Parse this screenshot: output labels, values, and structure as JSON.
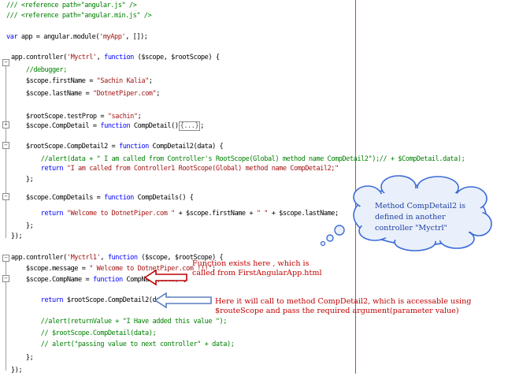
{
  "editor": {
    "lines": [
      [
        {
          "t": "/// <reference path=\"angular.js\" />",
          "c": "cm"
        }
      ],
      [
        {
          "t": "/// <reference path=\"angular.min.js\" />",
          "c": "cm"
        }
      ],
      [],
      [
        {
          "t": "var",
          "c": "kw"
        },
        {
          "t": " app = angular.module(",
          "c": "pl"
        },
        {
          "t": "'myApp'",
          "c": "str"
        },
        {
          "t": ", []);",
          "c": "pl"
        }
      ],
      [],
      [
        {
          "t": "app.controller(",
          "c": "pl"
        },
        {
          "t": "'Myctrl'",
          "c": "str"
        },
        {
          "t": ", ",
          "c": "pl"
        },
        {
          "t": "function",
          "c": "kw"
        },
        {
          "t": " ($scope, $rootScope) {",
          "c": "pl"
        }
      ],
      [
        {
          "t": "    //debugger;",
          "c": "cm"
        }
      ],
      [
        {
          "t": "    $scope.firstName = ",
          "c": "pl"
        },
        {
          "t": "\"Sachin Kalia\"",
          "c": "str"
        },
        {
          "t": ";",
          "c": "pl"
        }
      ],
      [
        {
          "t": "    $scope.lastName = ",
          "c": "pl"
        },
        {
          "t": "\"DotnetPiper.com\"",
          "c": "str"
        },
        {
          "t": ";",
          "c": "pl"
        }
      ],
      [],
      [
        {
          "t": "    $rootScope.testProp = ",
          "c": "pl"
        },
        {
          "t": "\"sachin\"",
          "c": "str"
        },
        {
          "t": ";",
          "c": "pl"
        }
      ],
      [
        {
          "t": "    $scope.CompDetail = ",
          "c": "pl"
        },
        {
          "t": "function",
          "c": "kw"
        },
        {
          "t": " CompDetail()",
          "c": "pl"
        },
        {
          "t": "{...}",
          "c": "box"
        },
        {
          "t": ";",
          "c": "pl"
        }
      ],
      [],
      [
        {
          "t": "    $rootScope.CompDetail2 = ",
          "c": "pl"
        },
        {
          "t": "function",
          "c": "kw"
        },
        {
          "t": " CompDetail2(data) {",
          "c": "pl"
        }
      ],
      [
        {
          "t": "        //alert(data + \" I am called from Controller's RootScope(Global) method name CompDetail2\");// + $CompDetail.data);",
          "c": "cm"
        }
      ],
      [
        {
          "t": "        ",
          "c": "pl"
        },
        {
          "t": "return",
          "c": "kw"
        },
        {
          "t": " ",
          "c": "pl"
        },
        {
          "t": "\"I am called from Controller1 RootScope(Global) method name CompDetail2;\"",
          "c": "str"
        }
      ],
      [
        {
          "t": "    };",
          "c": "pl"
        }
      ],
      [],
      [
        {
          "t": "    $scope.CompDetails = ",
          "c": "pl"
        },
        {
          "t": "function",
          "c": "kw"
        },
        {
          "t": " CompDetails() {",
          "c": "pl"
        }
      ],
      [
        {
          "t": "        ",
          "c": "pl"
        },
        {
          "t": "return",
          "c": "kw"
        },
        {
          "t": " ",
          "c": "pl"
        },
        {
          "t": "\"Welcome to DotnetPiper.com \"",
          "c": "str"
        },
        {
          "t": " + $scope.firstName + ",
          "c": "pl"
        },
        {
          "t": "\" \"",
          "c": "str"
        },
        {
          "t": " + $scope.lastName;",
          "c": "pl"
        }
      ],
      [
        {
          "t": "    };",
          "c": "pl"
        }
      ],
      [
        {
          "t": "});",
          "c": "pl"
        }
      ],
      [],
      [],
      [
        {
          "t": "app.controller(",
          "c": "pl"
        },
        {
          "t": "'Myctrl1'",
          "c": "str"
        },
        {
          "t": ", ",
          "c": "pl"
        },
        {
          "t": "function",
          "c": "kw"
        },
        {
          "t": " ($scope, $rootScope) {",
          "c": "pl"
        }
      ],
      [
        {
          "t": "    $scope.message = ",
          "c": "pl"
        },
        {
          "t": "\" Welcome to DotnetPiper.com !!!\"",
          "c": "str"
        },
        {
          "t": ";",
          "c": "pl"
        }
      ],
      [
        {
          "t": "    $scope.CompName = ",
          "c": "pl"
        },
        {
          "t": "function",
          "c": "kw"
        },
        {
          "t": " CompName(data) {",
          "c": "pl"
        }
      ],
      [],
      [
        {
          "t": "        ",
          "c": "pl"
        },
        {
          "t": "return",
          "c": "kw"
        },
        {
          "t": " $rootScope.CompDetail2(data);",
          "c": "pl"
        }
      ],
      [],
      [
        {
          "t": "        //alert(returnValue + \"I Have added this value \");",
          "c": "cm"
        }
      ],
      [
        {
          "t": "        // $rootScope.CompDetail(data);",
          "c": "cm"
        }
      ],
      [
        {
          "t": "        // alert(\"passing value to next controller\" + data);",
          "c": "cm"
        }
      ],
      [
        {
          "t": "    };",
          "c": "pl"
        }
      ],
      [
        {
          "t": "});",
          "c": "pl"
        }
      ]
    ]
  },
  "annotations": {
    "function_note": "Function exists here , which is\ncalled from FirstAngularApp.html",
    "call_note": "Here it will call to method CompDetail2, which is accessable using\n$routeScope and pass the required argument(parameter value)",
    "bubble_note": "Method CompDetail2 is\ndefined in another\ncontroller \"Myctrl\""
  },
  "colors": {
    "keyword": "#0000ff",
    "string": "#a31515",
    "comment": "#008000",
    "annotation_text": "#c00000",
    "bubble_text": "#1f3f9f",
    "bubble_fill": "#e9f0fb",
    "bubble_stroke": "#3b6bd6",
    "red_arrow": "#c00000",
    "blue_arrow": "#5a7ec0",
    "margin_line": "#e03a3a"
  }
}
